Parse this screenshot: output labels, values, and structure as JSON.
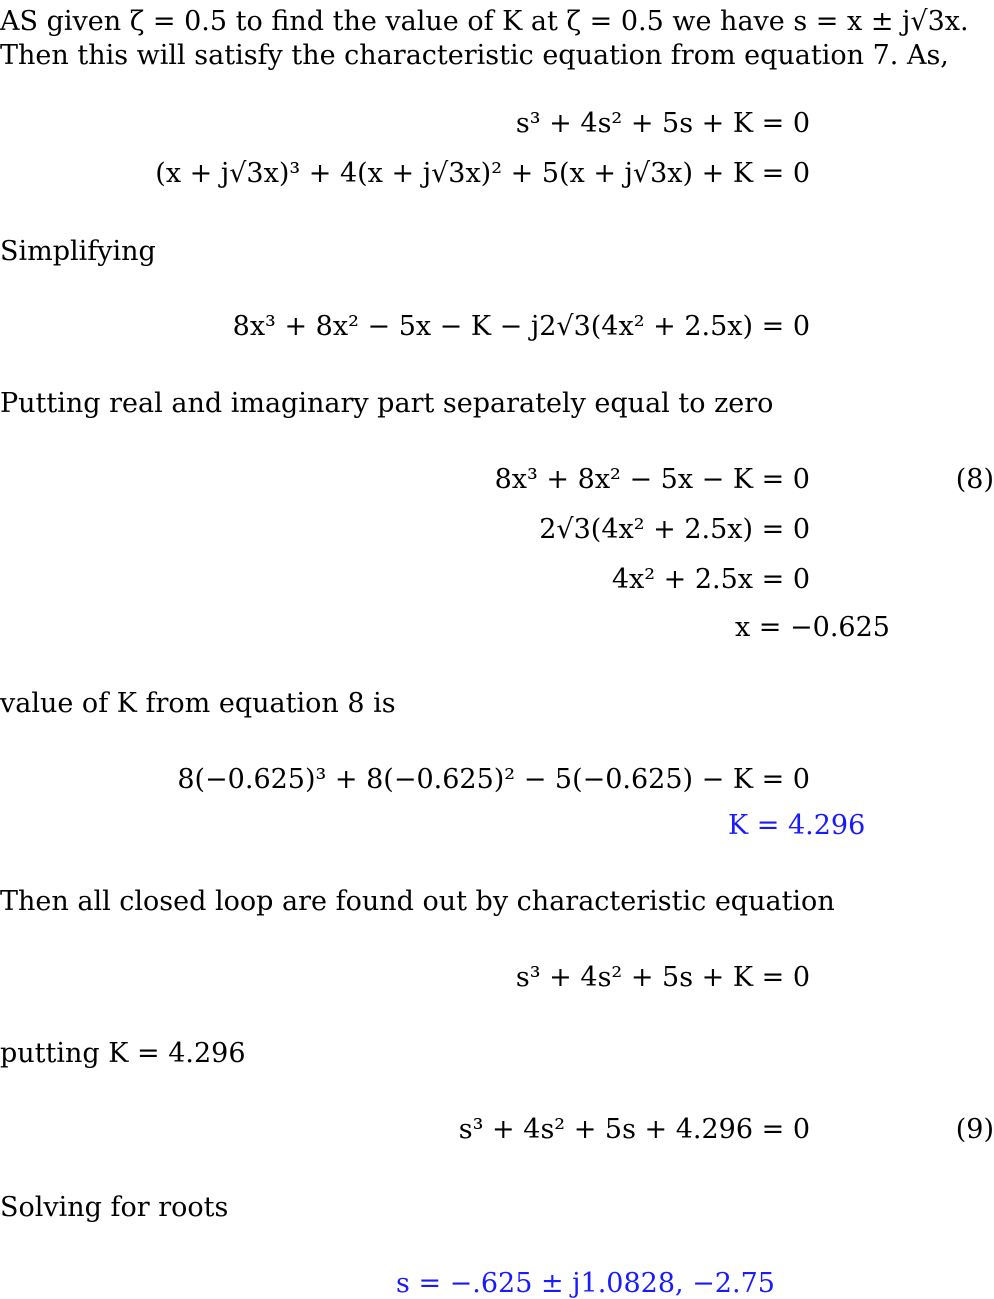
{
  "document": {
    "intro_line_1": "AS given ζ = 0.5 to find the value of K at ζ = 0.5 we have s = x ± j√3x.",
    "intro_line_2": "Then this will satisfy the characteristic equation from equation 7. As,",
    "eq_char": "s³ + 4s² + 5s + K = 0",
    "eq_sub": "(x + j√3x)³ + 4(x + j√3x)² + 5(x + j√3x) + K = 0",
    "simplifying_label": "Simplifying",
    "eq_simplified": "8x³ + 8x² − 5x − K − j2√3(4x² + 2.5x) = 0",
    "separate_label": "Putting real and imaginary part separately equal to zero",
    "eq_real": "8x³ + 8x² − 5x − K = 0",
    "eq_real_number": "(8)",
    "eq_imag": "2√3(4x² + 2.5x) = 0",
    "eq_imag2": "4x² + 2.5x = 0",
    "eq_x": "x = −0.625",
    "k_from_label": "value of K from equation 8 is",
    "eq_k_sub": "8(−0.625)³ + 8(−0.625)² − 5(−0.625) − K = 0",
    "eq_k_result": "K = 4.296",
    "closed_loop_label": "Then all closed loop are found out by characteristic equation",
    "eq_char2": "s³ + 4s² + 5s + K = 0",
    "putting_label": "putting K = 4.296",
    "eq_final": "s³ + 4s² + 5s + 4.296 = 0",
    "eq_final_number": "(9)",
    "roots_label": "Solving for roots",
    "eq_roots": "s = −.625 ± j1.0828, −2.75"
  },
  "colors": {
    "text": "#000000",
    "highlight": "#1a1aff",
    "background": "#ffffff"
  }
}
